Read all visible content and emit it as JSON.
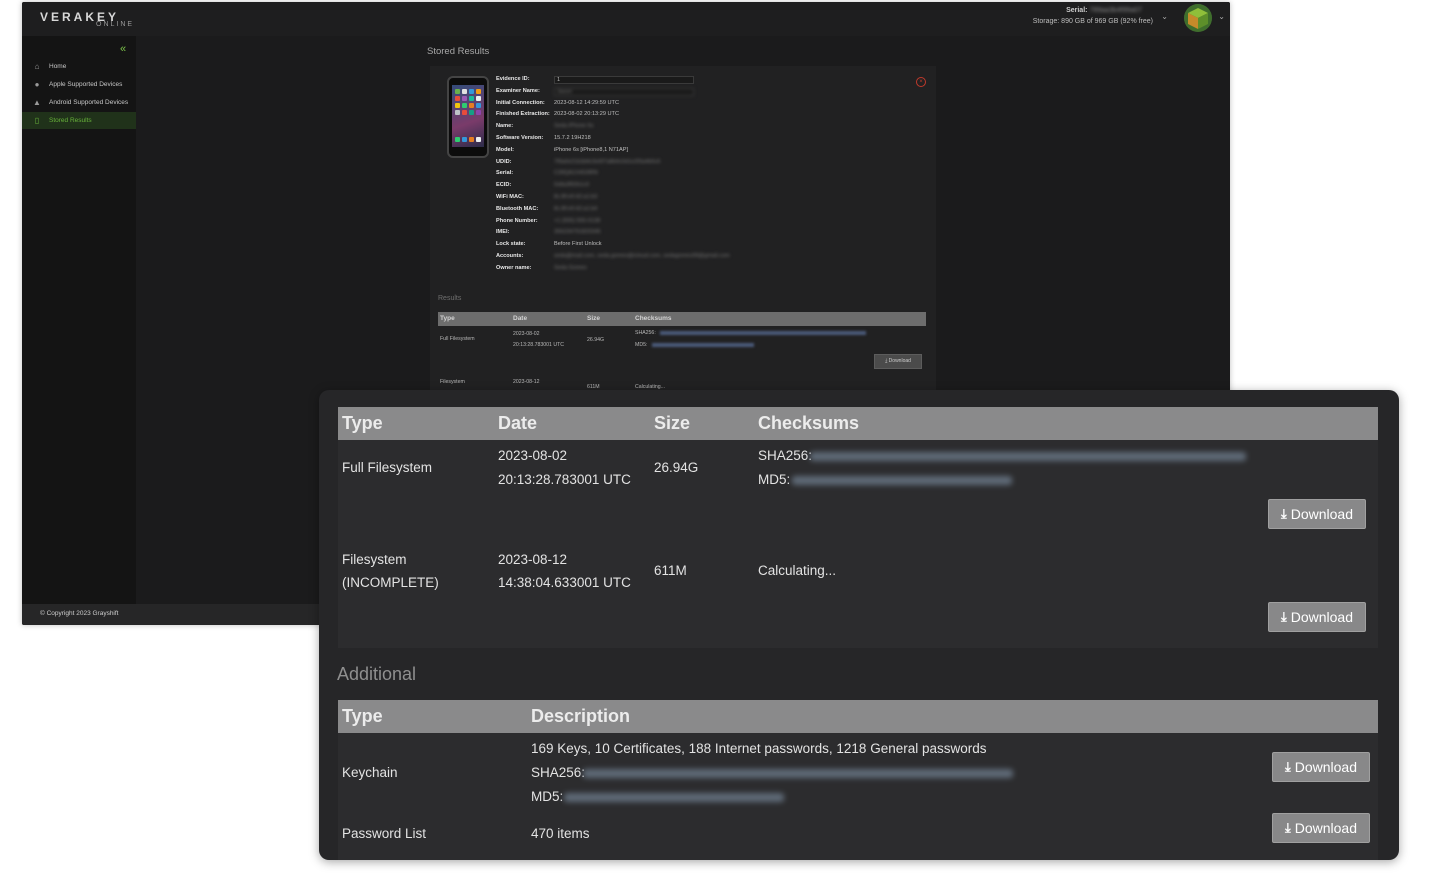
{
  "app": {
    "logo": "VERAKEY",
    "logo_sub": "ONLINE",
    "serial_label": "Serial:",
    "serial_value": "789aa3b4f99a07",
    "storage": "Storage: 890 GB of 969 GB (92% free)",
    "copyright": "© Copyright 2023 Grayshift",
    "accent_color": "#67b23a"
  },
  "sidebar": {
    "items": [
      {
        "label": "Home",
        "icon": "home-icon"
      },
      {
        "label": "Apple Supported Devices",
        "icon": "apple-icon"
      },
      {
        "label": "Android Supported Devices",
        "icon": "android-icon"
      },
      {
        "label": "Stored Results",
        "icon": "phone-icon",
        "active": true
      }
    ]
  },
  "page": {
    "heading": "Stored Results"
  },
  "details": {
    "rows": [
      {
        "key": "Evidence ID:",
        "value": "1",
        "input": true
      },
      {
        "key": "Examiner Name:",
        "value": "Jason",
        "input": true,
        "blurred": true
      },
      {
        "key": "Initial Connection:",
        "value": "2023-08-12 14:29:59 UTC"
      },
      {
        "key": "Finished Extraction:",
        "value": "2023-08-02 20:13:29 UTC"
      },
      {
        "key": "Name:",
        "value": "Seda iPhone 6s",
        "blurred": true
      },
      {
        "key": "Software Version:",
        "value": "15.7.2 19H218"
      },
      {
        "key": "Model:",
        "value": "iPhone 6s [iPhone8,1 N71AP]"
      },
      {
        "key": "UDID:",
        "value": "7f9a0e21b3d4c5e6f7a8b9c0d1e2f3a4b5c6",
        "blurred": true
      },
      {
        "key": "Serial:",
        "value": "C39QA1X4G9RN",
        "blurred": true
      },
      {
        "key": "ECID:",
        "value": "0x8a3f92b1c0",
        "blurred": true
      },
      {
        "key": "WiFi MAC:",
        "value": "8c:8f:e9:42:a1:b3",
        "blurred": true
      },
      {
        "key": "Bluetooth MAC:",
        "value": "8c:8f:e9:42:a1:b4",
        "blurred": true
      },
      {
        "key": "Phone Number:",
        "value": "+1 (555) 555-0138",
        "blurred": true
      },
      {
        "key": "IMEI:",
        "value": "356234791820345",
        "blurred": true
      },
      {
        "key": "Lock state:",
        "value": "Before First Unlock"
      },
      {
        "key": "Accounts:",
        "value": "seda@mail.com, seda.gomes@icloud.com, sedagomes99@gmail.com",
        "blurred": true
      },
      {
        "key": "Owner name:",
        "value": "Seda Gomes",
        "blurred": true
      }
    ]
  },
  "small_results": {
    "label": "Results",
    "headers": [
      "Type",
      "Date",
      "Size",
      "Checksums"
    ],
    "row1": {
      "type": "Full Filesystem",
      "date1": "2023-08-02",
      "date2": "20:13:28.783001 UTC",
      "size": "26.94G",
      "sha": "SHA256:",
      "md5": "MD5:"
    },
    "row2": {
      "type": "Filesystem",
      "date1": "2023-08-12",
      "size": "611M",
      "checksum": "Calculating..."
    },
    "download": "Download"
  },
  "results": {
    "headers": [
      "Type",
      "Date",
      "Size",
      "Checksums"
    ],
    "rows": [
      {
        "type": "Full Filesystem",
        "type2": "",
        "date1": "2023-08-02",
        "date2": "20:13:28.783001 UTC",
        "size": "26.94G",
        "sha_label": "SHA256:",
        "md5_label": "MD5:",
        "checksum": ""
      },
      {
        "type": "Filesystem",
        "type2": "(INCOMPLETE)",
        "date1": "2023-08-12",
        "date2": "14:38:04.633001 UTC",
        "size": "611M",
        "checksum": "Calculating..."
      }
    ],
    "download_label": "Download"
  },
  "additional": {
    "title": "Additional",
    "headers": [
      "Type",
      "Description"
    ],
    "rows": [
      {
        "type": "Keychain",
        "description": "169 Keys, 10 Certificates, 188 Internet passwords, 1218 General passwords",
        "sha_label": "SHA256:",
        "md5_label": "MD5:"
      },
      {
        "type": "Password List",
        "description": "470 items"
      }
    ],
    "download_label": "Download"
  }
}
